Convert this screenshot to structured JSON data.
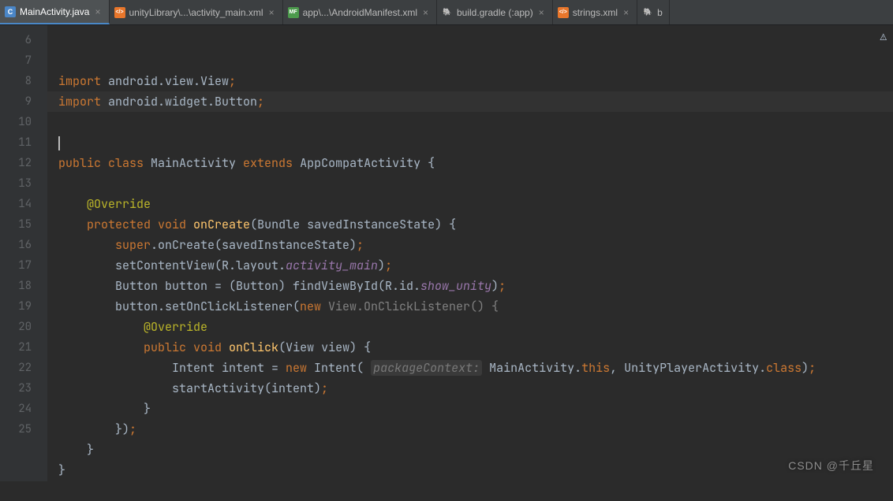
{
  "tabs": [
    {
      "icon_bg": "#4A86C7",
      "icon_fg": "#FFF",
      "icon_txt": "C",
      "label": "MainActivity.java",
      "active": true
    },
    {
      "icon_bg": "#E8762B",
      "icon_fg": "#FFF",
      "icon_txt": "</>",
      "label": "unityLibrary\\...\\activity_main.xml"
    },
    {
      "icon_bg": "#4C9A4C",
      "icon_fg": "#FFF",
      "icon_txt": "MF",
      "label": "app\\...\\AndroidManifest.xml"
    },
    {
      "icon_bg": "#6B6B6B",
      "icon_fg": "#CFCFCF",
      "icon_txt": "🐘",
      "label": "build.gradle (:app)"
    },
    {
      "icon_bg": "#E8762B",
      "icon_fg": "#FFF",
      "icon_txt": "</>",
      "label": "strings.xml"
    },
    {
      "icon_bg": "#6B6B6B",
      "icon_fg": "#CFCFCF",
      "icon_txt": "🐘",
      "label": "b"
    }
  ],
  "close_glyph": "×",
  "gutter_lines": [
    "6",
    "7",
    "8",
    "9",
    "10",
    "11",
    "12",
    "13",
    "14",
    "15",
    "16",
    "17",
    "18",
    "19",
    "20",
    "21",
    "22",
    "23",
    "24",
    "25"
  ],
  "gutter_marks": {
    "13": "🔵↑",
    "19": "🟢↑"
  },
  "warning_glyph": "⚠",
  "watermark": "CSDN @千丘星",
  "code": {
    "l6": {
      "import": "import",
      "rest": " android.view.View",
      "semi": ";"
    },
    "l7": {
      "import": "import",
      "rest": " android.widget.Button",
      "semi": ";"
    },
    "l10": {
      "kw_public": "public",
      "kw_class": " class ",
      "name": "MainActivity",
      "kw_extends": " extends ",
      "super": "AppCompatActivity",
      "brace": " {"
    },
    "l12": {
      "ann": "@Override"
    },
    "l13": {
      "kw_protected": "protected",
      "kw_void": " void ",
      "fn": "onCreate",
      "params": "(Bundle savedInstanceState) {"
    },
    "l14": {
      "kw_super": "super",
      "call": ".onCreate(savedInstanceState)",
      "semi": ";"
    },
    "l15": {
      "call": "setContentView(R.layout.",
      "field": "activity_main",
      "rest": ")",
      "semi": ";"
    },
    "l16": {
      "type": "Button button = (Button) findViewById(R.id.",
      "field": "show_unity",
      "rest": ")",
      "semi": ";"
    },
    "l17": {
      "start": "button.setOnClickListener(",
      "kw_new": "new",
      "gray": " View.OnClickListener() {"
    },
    "l18": {
      "ann": "@Override"
    },
    "l19": {
      "kw_public": "public",
      "kw_void": " void ",
      "fn": "onClick",
      "params": "(View view) {"
    },
    "l20": {
      "start": "Intent intent = ",
      "kw_new": "new",
      "ctor": " Intent( ",
      "hint": "packageContext:",
      "mid": " MainActivity.",
      "kw_this": "this",
      "comma": ", UnityPlayerActivity.",
      "kw_class": "class",
      "end": ")",
      "semi": ";"
    },
    "l21": {
      "call": "startActivity(intent)",
      "semi": ";"
    },
    "l22": {
      "brace": "}"
    },
    "l23": {
      "brace": "})",
      "semi": ";"
    },
    "l24": {
      "brace": "}"
    },
    "l25": {
      "brace": "}"
    }
  }
}
